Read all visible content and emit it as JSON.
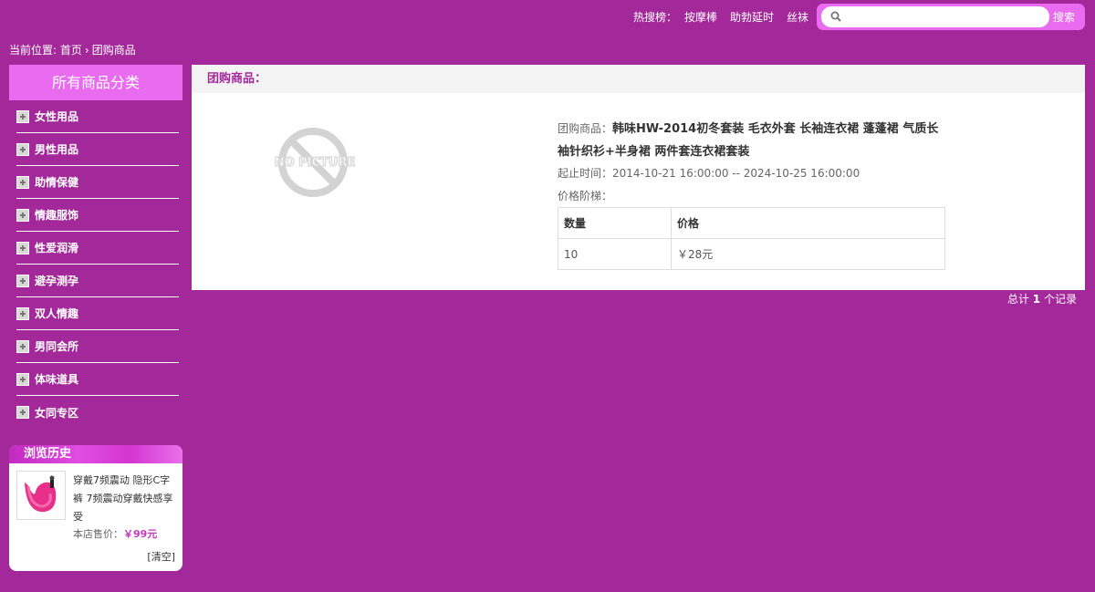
{
  "header": {
    "hot_label": "热搜榜：",
    "hot_terms": [
      "按摩棒",
      "助勃延时",
      "丝袜"
    ],
    "search_placeholder": "",
    "search_button": "搜索"
  },
  "breadcrumb": {
    "prefix": "当前位置:",
    "home": "首页",
    "current": "团购商品"
  },
  "sidebar": {
    "title": "所有商品分类",
    "categories": [
      "女性用品",
      "男性用品",
      "助情保健",
      "情趣服饰",
      "性爱润滑",
      "避孕测孕",
      "双人情趣",
      "男同会所",
      "体味道具",
      "女同专区"
    ]
  },
  "history": {
    "title": "浏览历史",
    "item_name": "穿戴7频震动 隐形C字裤 7频震动穿戴快感享受",
    "price_label": "本店售价：",
    "price": "￥99元",
    "clear": "[清空]"
  },
  "main": {
    "title": "团购商品：",
    "no_picture": "NO PICTURE",
    "product_label": "团购商品：",
    "product_name": "韩味HW-2014初冬套装 毛衣外套 长袖连衣裙 蓬蓬裙 气质长袖针织衫+半身裙 两件套连衣裙套装",
    "time_label": "起止时间：",
    "time_range": "2014-10-21 16:00:00 -- 2024-10-25 16:00:00",
    "tier_label": "价格阶梯：",
    "tier_headers": [
      "数量",
      "价格"
    ],
    "tier_rows": [
      [
        "10",
        "￥28元"
      ]
    ]
  },
  "footer": {
    "total_prefix": "总计",
    "total_count": "1",
    "total_suffix": "个记录"
  },
  "colors": {
    "background": "#a3289a",
    "accent_pink": "#e96cf0",
    "price": "#c23ab8"
  }
}
